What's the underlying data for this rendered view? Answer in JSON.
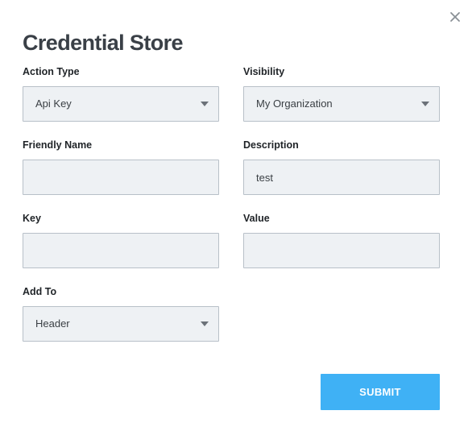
{
  "dialog": {
    "title": "Credential Store",
    "close_icon": "close-icon"
  },
  "fields": {
    "action_type": {
      "label": "Action Type",
      "value": "Api Key"
    },
    "visibility": {
      "label": "Visibility",
      "value": "My Organization"
    },
    "friendly_name": {
      "label": "Friendly Name",
      "value": ""
    },
    "description": {
      "label": "Description",
      "value": "test"
    },
    "key": {
      "label": "Key",
      "value": ""
    },
    "value": {
      "label": "Value",
      "value": ""
    },
    "add_to": {
      "label": "Add To",
      "value": "Header"
    }
  },
  "submit_label": "SUBMIT",
  "colors": {
    "submit_bg": "#3fb1f5",
    "field_bg": "#eef1f4",
    "field_border": "#b8c0c8"
  }
}
